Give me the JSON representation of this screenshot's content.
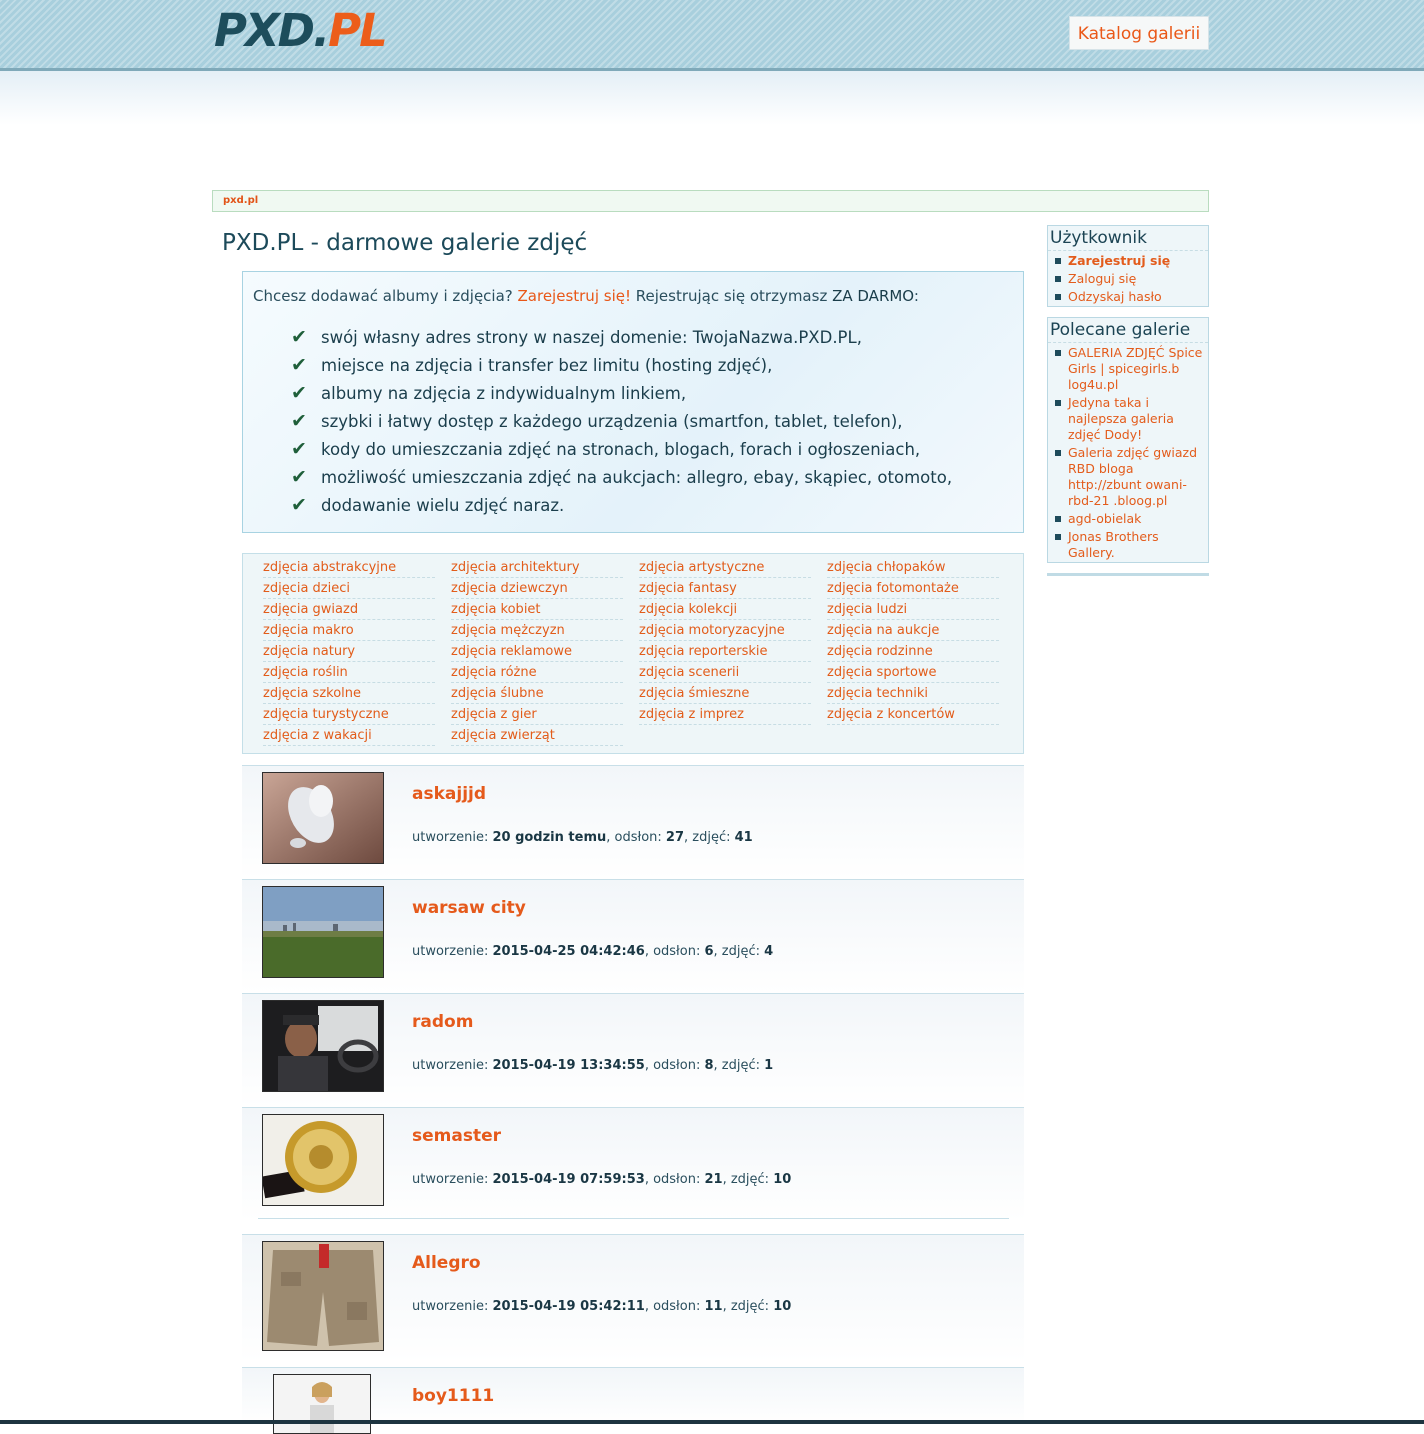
{
  "header": {
    "logo_part1": "PXD.",
    "logo_part2": "PL",
    "catalog_button": "Katalog galerii"
  },
  "breadcrumb": "pxd.pl",
  "main": {
    "title": "PXD.PL - darmowe galerie zdjęć",
    "promo": {
      "intro_prefix": "Chcesz dodawać albumy i zdjęcia? ",
      "register_link": "Zarejestruj się!",
      "intro_middle": " Rejestrując się otrzymasz ",
      "free_text": "ZA DARMO",
      "intro_suffix": ":",
      "benefits": [
        "swój własny adres strony w naszej domenie: TwojaNazwa.PXD.PL,",
        "miejsce na zdjęcia i transfer bez limitu (hosting zdjęć),",
        "albumy na zdjęcia z indywidualnym linkiem,",
        "szybki i łatwy dostęp z każdego urządzenia (smartfon, tablet, telefon),",
        "kody do umieszczania zdjęć na stronach, blogach, forach i ogłoszeniach,",
        "możliwość umieszczania zdjęć na aukcjach: allegro, ebay, skąpiec, otomoto,",
        "dodawanie wielu zdjęć naraz."
      ]
    },
    "categories": [
      "zdjęcia abstrakcyjne",
      "zdjęcia architektury",
      "zdjęcia artystyczne",
      "zdjęcia chłopaków",
      "zdjęcia dzieci",
      "zdjęcia dziewczyn",
      "zdjęcia fantasy",
      "zdjęcia fotomontaże",
      "zdjęcia gwiazd",
      "zdjęcia kobiet",
      "zdjęcia kolekcji",
      "zdjęcia ludzi",
      "zdjęcia makro",
      "zdjęcia mężczyzn",
      "zdjęcia motoryzacyjne",
      "zdjęcia na aukcje",
      "zdjęcia natury",
      "zdjęcia reklamowe",
      "zdjęcia reporterskie",
      "zdjęcia rodzinne",
      "zdjęcia roślin",
      "zdjęcia różne",
      "zdjęcia scenerii",
      "zdjęcia sportowe",
      "zdjęcia szkolne",
      "zdjęcia ślubne",
      "zdjęcia śmieszne",
      "zdjęcia techniki",
      "zdjęcia turystyczne",
      "zdjęcia z gier",
      "zdjęcia z imprez",
      "zdjęcia z koncertów",
      "zdjęcia z wakacji",
      "zdjęcia zwierząt"
    ],
    "gallery_labels": {
      "created": "utworzenie: ",
      "views": ", odsłon: ",
      "photos": ", zdjęć: "
    },
    "galleries": [
      {
        "name": "askajjjd",
        "created": "20 godzin temu",
        "views": "27",
        "photos": "41"
      },
      {
        "name": "warsaw city",
        "created": "2015-04-25 04:42:46",
        "views": "6",
        "photos": "4"
      },
      {
        "name": "radom",
        "created": "2015-04-19 13:34:55",
        "views": "8",
        "photos": "1"
      },
      {
        "name": "semaster",
        "created": "2015-04-19 07:59:53",
        "views": "21",
        "photos": "10"
      },
      {
        "name": "Allegro",
        "created": "2015-04-19 05:42:11",
        "views": "11",
        "photos": "10"
      },
      {
        "name": "boy1111"
      }
    ]
  },
  "sidebar": {
    "user_box": {
      "title": "Użytkownik",
      "items": [
        "Zarejestruj się",
        "Zaloguj się",
        "Odzyskaj hasło"
      ]
    },
    "recommended_box": {
      "title": "Polecane galerie",
      "items": [
        "GALERIA ZDJĘĆ Spice Girls | spicegirls.b log4u.pl",
        "Jedyna taka i najlepsza galeria zdjęć Dody!",
        "Galeria zdjęć gwiazd RBD bloga http://zbunt owani-rbd-21 .bloog.pl",
        "agd-obielak",
        "Jonas Brothers Gallery."
      ]
    }
  }
}
